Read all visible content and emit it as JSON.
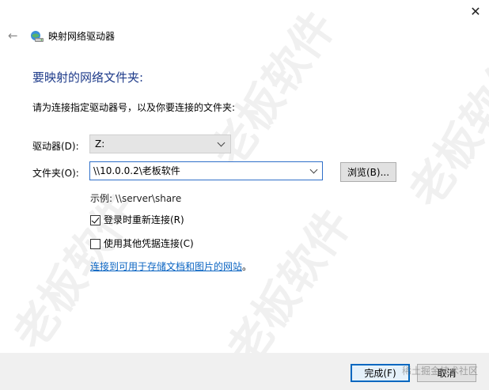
{
  "window": {
    "title": "映射网络驱动器",
    "close_glyph": "✕",
    "back_glyph": "←"
  },
  "main": {
    "heading": "要映射的网络文件夹:",
    "instruction": "请为连接指定驱动器号，以及你要连接的文件夹:",
    "drive_label": "驱动器(D):",
    "drive_value": "Z:",
    "folder_label": "文件夹(O):",
    "folder_value": "\\\\10.0.0.2\\老板软件",
    "browse_label": "浏览(B)...",
    "example": "示例: \\\\server\\share",
    "reconnect_label": "登录时重新连接(R)",
    "reconnect_checked": true,
    "other_creds_label": "使用其他凭据连接(C)",
    "other_creds_checked": false,
    "link_text": "连接到可用于存储文档和图片的网站",
    "link_suffix": "。"
  },
  "footer": {
    "finish_label": "完成(F)",
    "cancel_label": "取消"
  },
  "watermark": {
    "text": "老板软件",
    "tag": "稀土掘金技术社区"
  },
  "icons": {
    "back": "arrow-left-icon",
    "title": "network-drive-icon",
    "close": "close-icon",
    "chevron": "chevron-down-icon",
    "check": "checkmark-icon"
  },
  "colors": {
    "heading": "#1e3b8a",
    "link": "#0a64c2",
    "focus_border": "#2f6fc9",
    "footer_bg": "#f0f0f0",
    "default_button_border": "#0067c0"
  }
}
